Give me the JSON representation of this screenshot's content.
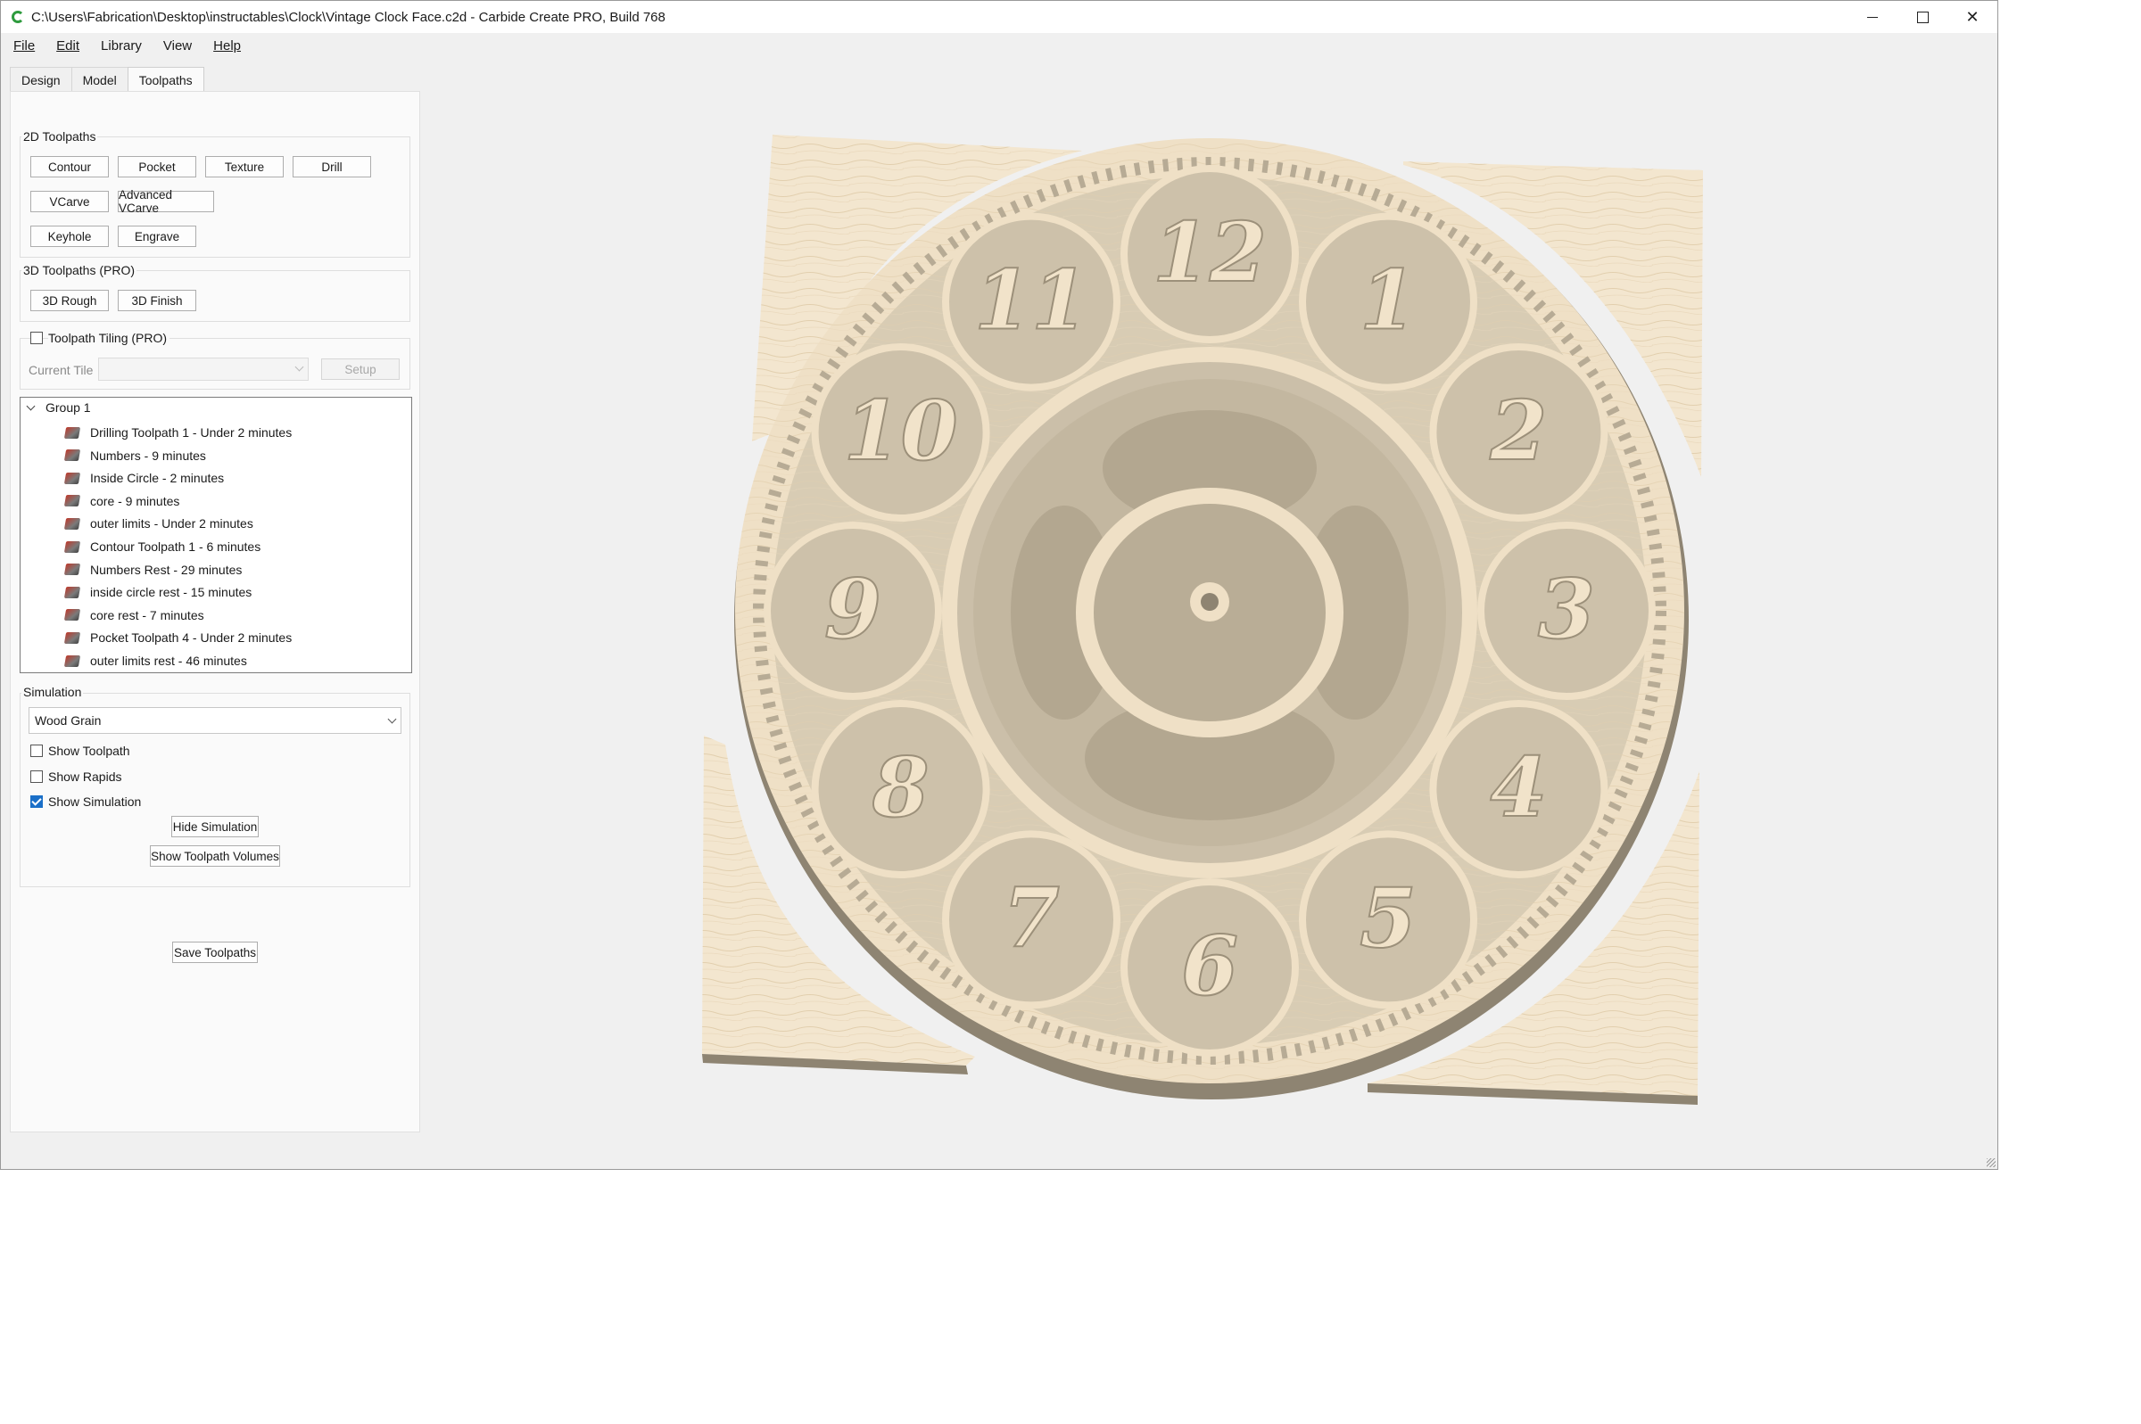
{
  "window": {
    "title": "C:\\Users\\Fabrication\\Desktop\\instructables\\Clock\\Vintage Clock Face.c2d - Carbide Create PRO, Build 768",
    "controls": [
      "minimize-icon",
      "maximize-icon",
      "close-icon"
    ]
  },
  "menu": {
    "file": "File",
    "edit": "Edit",
    "library": "Library",
    "view": "View",
    "help": "Help"
  },
  "tabs": {
    "design": "Design",
    "model": "Model",
    "toolpaths": "Toolpaths",
    "active": "Toolpaths"
  },
  "toolpaths_2d": {
    "title": "2D Toolpaths",
    "contour": "Contour",
    "pocket": "Pocket",
    "texture": "Texture",
    "drill": "Drill",
    "vcarve": "VCarve",
    "advanced_vcarve": "Advanced VCarve",
    "keyhole": "Keyhole",
    "engrave": "Engrave"
  },
  "toolpaths_3d": {
    "title": "3D Toolpaths (PRO)",
    "rough": "3D Rough",
    "finish": "3D Finish"
  },
  "tiling": {
    "label": "Toolpath Tiling (PRO)",
    "checked": false,
    "current_tile_label": "Current Tile",
    "current_tile_value": "",
    "setup": "Setup"
  },
  "toolpath_tree": {
    "group": "Group 1",
    "items": [
      "Drilling Toolpath 1 - Under 2 minutes",
      "Numbers - 9 minutes",
      "Inside Circle - 2 minutes",
      "core - 9 minutes",
      "outer limits - Under 2 minutes",
      "Contour Toolpath 1 - 6 minutes",
      "Numbers Rest - 29 minutes",
      "inside circle rest - 15 minutes",
      "core rest - 7 minutes",
      "Pocket Toolpath 4 - Under 2 minutes",
      "outer limits rest - 46 minutes"
    ]
  },
  "simulation": {
    "title": "Simulation",
    "material": "Wood Grain",
    "show_toolpath": "Show Toolpath",
    "show_toolpath_checked": false,
    "show_rapids": "Show Rapids",
    "show_rapids_checked": false,
    "show_simulation": "Show Simulation",
    "show_simulation_checked": true,
    "hide_simulation": "Hide Simulation",
    "show_volumes": "Show Toolpath Volumes"
  },
  "save_toolpaths": "Save Toolpaths",
  "clock_numerals": [
    "12",
    "1",
    "2",
    "3",
    "4",
    "5",
    "6",
    "7",
    "8",
    "9",
    "10",
    "11"
  ],
  "colors": {
    "wood_light": "#f3e6cf",
    "wood_mid": "#e6d7bd",
    "carved": "#cbbfa9",
    "center_dark": "#bdb19c",
    "edge": "#8e8472",
    "checkbox_accent": "#1a6fc8"
  }
}
